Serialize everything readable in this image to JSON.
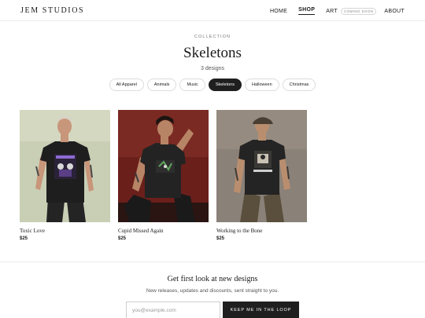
{
  "header": {
    "logo": "JEM STUDIOS",
    "nav": {
      "home": "HOME",
      "shop": "SHOP",
      "art": "ART",
      "art_badge": "COMING SOON",
      "about": "ABOUT"
    }
  },
  "collection": {
    "eyebrow": "COLLECTION",
    "title": "Skeletons",
    "count": "3 designs"
  },
  "filters": {
    "active": "Skeletons",
    "items": [
      "All Apparel",
      "Animals",
      "Music",
      "Skeletons",
      "Halloween",
      "Christmas"
    ]
  },
  "products": [
    {
      "name": "Toxic Love",
      "price": "$25",
      "bg": "#c9cfb5"
    },
    {
      "name": "Cupid Missed Again",
      "price": "$25",
      "bg": "#6a1f1b"
    },
    {
      "name": "Working to the Bone",
      "price": "$25",
      "bg": "#8a8178"
    }
  ],
  "newsletter": {
    "title": "Get first look at new designs",
    "subtitle": "New releases, updates and discounts, sent straight to you.",
    "placeholder": "you@example.com",
    "button": "KEEP ME IN THE LOOP"
  },
  "colors": {
    "accent": "#1f1f1f",
    "divider": "#ececec"
  }
}
